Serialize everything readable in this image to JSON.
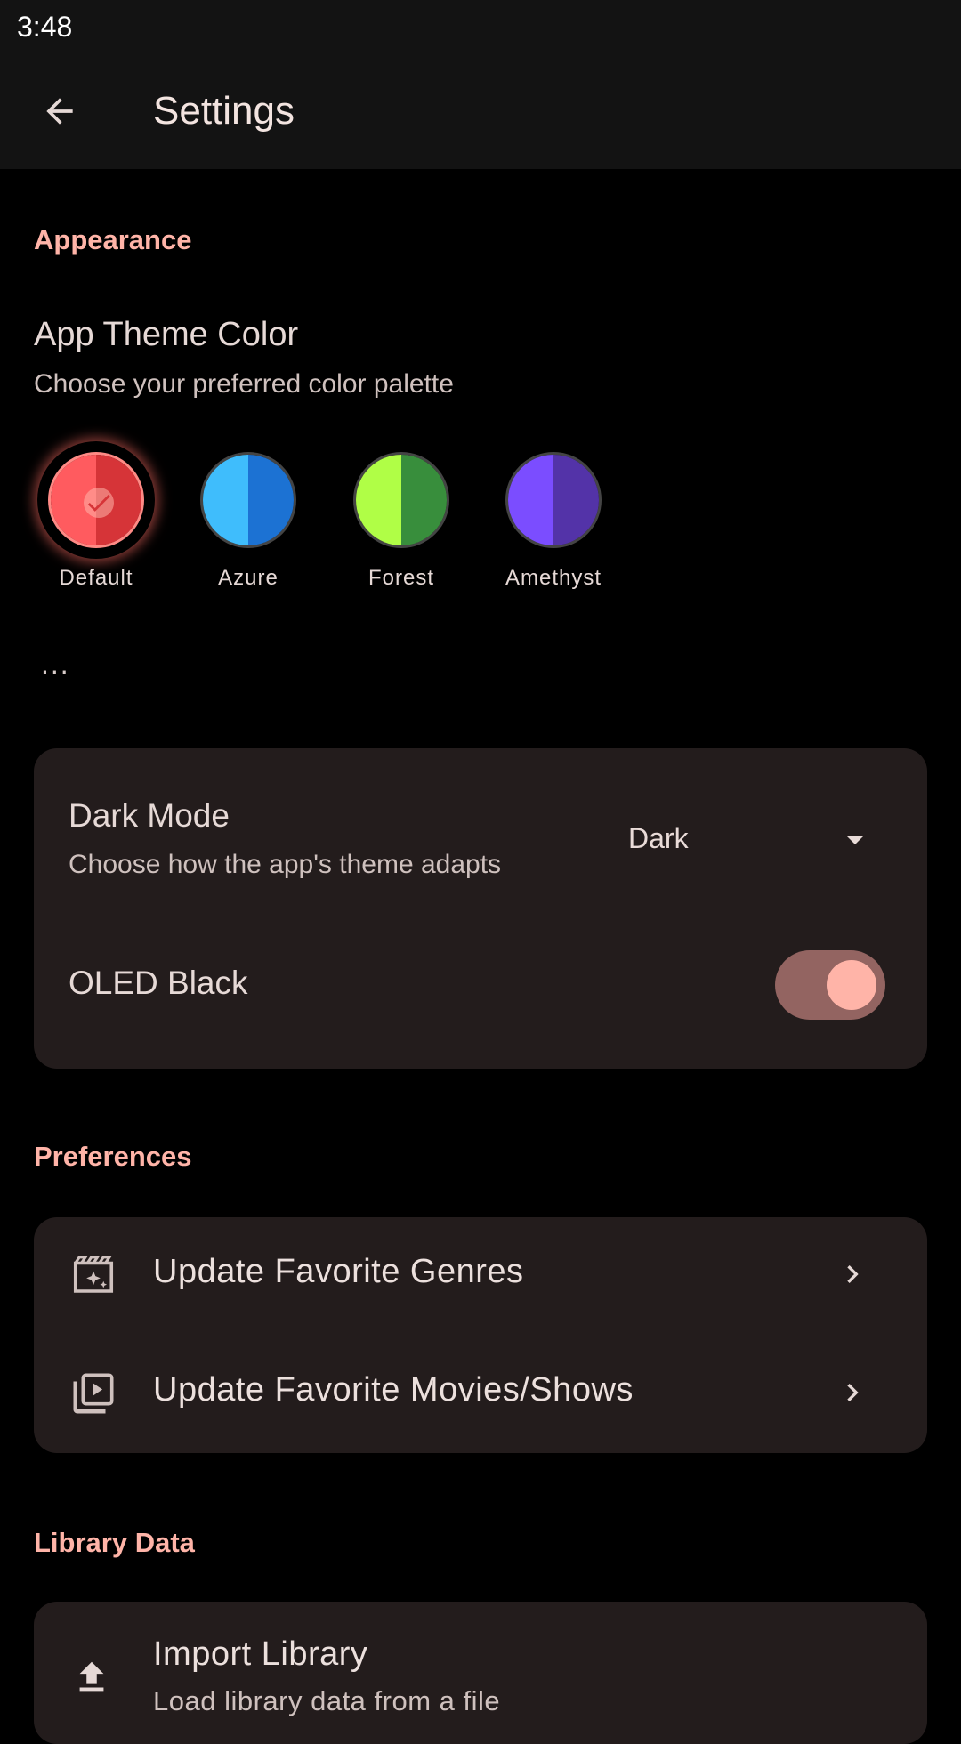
{
  "status_bar": {
    "time": "3:48"
  },
  "app_bar": {
    "title": "Settings"
  },
  "appearance": {
    "section_label": "Appearance",
    "theme": {
      "title": "App Theme Color",
      "subtitle": "Choose your preferred color palette",
      "swatches": [
        {
          "label": "Default",
          "left_color": "#ff5b5f",
          "right_color": "#d63438",
          "selected": true
        },
        {
          "label": "Azure",
          "left_color": "#3fbdfc",
          "right_color": "#1c72d3",
          "selected": false
        },
        {
          "label": "Forest",
          "left_color": "#b0fe46",
          "right_color": "#388e3c",
          "selected": false
        },
        {
          "label": "Amethyst",
          "left_color": "#7b4dff",
          "right_color": "#5333a8",
          "selected": false
        }
      ],
      "more_label": "..."
    },
    "dark_mode": {
      "title": "Dark Mode",
      "subtitle": "Choose how the app's theme adapts",
      "selected_value": "Dark"
    },
    "oled_black": {
      "title": "OLED Black",
      "enabled": true
    }
  },
  "preferences": {
    "section_label": "Preferences",
    "items": [
      {
        "label": "Update Favorite Genres",
        "icon": "movie-sparkle-icon"
      },
      {
        "label": "Update Favorite Movies/Shows",
        "icon": "video-library-icon"
      }
    ]
  },
  "library_data": {
    "section_label": "Library Data",
    "import": {
      "title": "Import Library",
      "subtitle": "Load library data from a file"
    }
  },
  "colors": {
    "accent": "#ffb4a8",
    "card_bg": "#231c1c",
    "toggle_track": "#936461"
  }
}
